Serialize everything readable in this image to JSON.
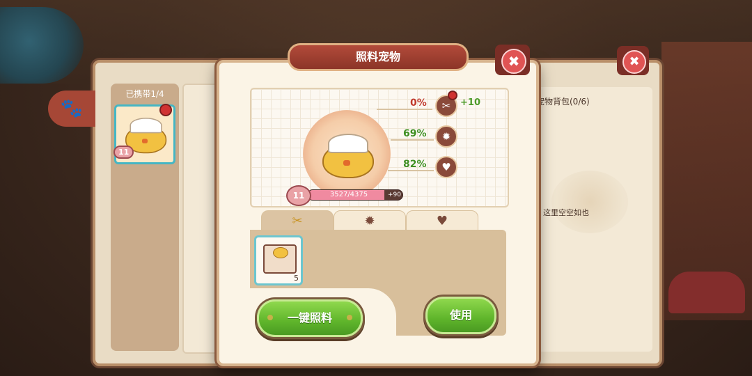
{
  "dialog": {
    "title": "照料宠物",
    "close_icon": "close-icon"
  },
  "back_window": {
    "carry_label": "已携带1/4",
    "carried_pet_level": "11",
    "help_label": "?",
    "bag_title": "宠物背包(0/6)",
    "empty_text": "这里空空如也"
  },
  "pet": {
    "level": "11",
    "exp_text": "3527/4375",
    "exp_fraction": 0.806,
    "exp_gain": "+90",
    "stats": [
      {
        "name": "hunger",
        "value": "0%",
        "color": "#c0392b",
        "icon": "fork-spoon-icon",
        "bonus": "+10"
      },
      {
        "name": "mood",
        "value": "69%",
        "color": "#3f8f22",
        "icon": "sun-icon"
      },
      {
        "name": "affection",
        "value": "82%",
        "color": "#3f8f22",
        "icon": "heart-icon"
      }
    ]
  },
  "tabs": [
    {
      "name": "food",
      "icon": "fork-spoon-icon",
      "active": true
    },
    {
      "name": "play",
      "icon": "sun-icon",
      "active": false
    },
    {
      "name": "love",
      "icon": "heart-icon",
      "active": false
    }
  ],
  "items": [
    {
      "name": "chick-bento",
      "count": "5"
    }
  ],
  "buttons": {
    "feed_all": "一键照料",
    "use": "使用"
  },
  "colors": {
    "accent_green": "#5fb52b",
    "title_red": "#8c3528",
    "cyan_border": "#45b6c4"
  }
}
